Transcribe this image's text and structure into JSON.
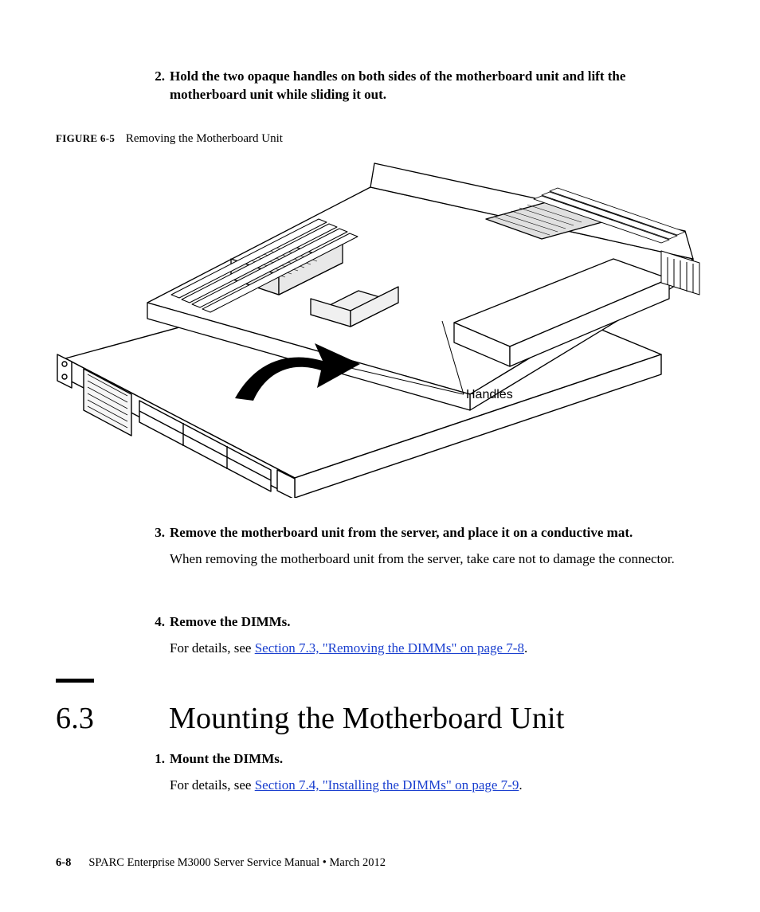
{
  "steps_top": {
    "s2": {
      "num": "2.",
      "text": "Hold the two opaque handles on both sides of the motherboard unit and lift the motherboard unit while sliding it out."
    }
  },
  "figure": {
    "label_id": "FIGURE 6-5",
    "caption": "Removing the Motherboard Unit",
    "callout_handles": "Handles"
  },
  "steps_mid": {
    "s3": {
      "num": "3.",
      "bold": "Remove the motherboard unit from the server, and place it on a conductive mat.",
      "para": "When removing the motherboard unit from the server, take care not to damage the connector."
    },
    "s4": {
      "num": "4.",
      "bold": "Remove the DIMMs.",
      "para_prefix": "For details, see ",
      "para_link": "Section 7.3, \"Removing the DIMMs\" on page 7-8",
      "para_suffix": "."
    }
  },
  "section": {
    "num": "6.3",
    "title": "Mounting the Motherboard Unit"
  },
  "steps_bottom": {
    "s1": {
      "num": "1.",
      "bold": "Mount the DIMMs.",
      "para_prefix": "For details, see ",
      "para_link": "Section 7.4, \"Installing the DIMMs\" on page 7-9",
      "para_suffix": "."
    }
  },
  "footer": {
    "pagenum": "6-8",
    "title": "SPARC Enterprise M3000 Server Service Manual  •  March 2012"
  }
}
